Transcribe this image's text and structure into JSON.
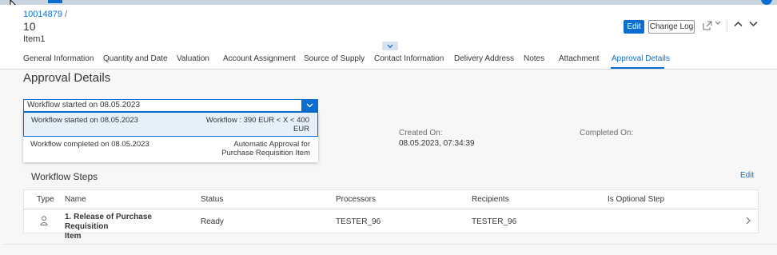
{
  "header": {
    "breadcrumb": "10014879",
    "breadcrumb_sep": "/",
    "title": "10",
    "subtitle": "Item1",
    "edit_label": "Edit",
    "changelog_label": "Change Log"
  },
  "tabs": [
    {
      "label": "General Information"
    },
    {
      "label": "Quantity and Date"
    },
    {
      "label": "Valuation"
    },
    {
      "label": "Account Assignment"
    },
    {
      "label": "Source of Supply"
    },
    {
      "label": "Contact Information"
    },
    {
      "label": "Delivery Address"
    },
    {
      "label": "Notes"
    },
    {
      "label": "Attachment"
    },
    {
      "label": "Approval Details"
    }
  ],
  "active_tab": "Approval Details",
  "section": {
    "title": "Approval Details",
    "workflow_select": {
      "value": "Workflow started on 08.05.2023",
      "options": [
        {
          "label": "Workflow started on 08.05.2023",
          "detail_line1": "Workflow : 390 EUR < X < 400",
          "detail_line2": "EUR"
        },
        {
          "label": "Workflow completed on 08.05.2023",
          "detail_line1": "Automatic Approval for",
          "detail_line2": "Purchase Requisition Item"
        }
      ]
    },
    "created_on_label": "Created On:",
    "created_on_value": "08.05.2023, 07:34:39",
    "completed_on_label": "Completed On:"
  },
  "steps": {
    "title": "Workflow Steps",
    "edit_label": "Edit",
    "columns": {
      "type": "Type",
      "name": "Name",
      "status": "Status",
      "processors": "Processors",
      "recipients": "Recipients",
      "optional": "Is Optional Step"
    },
    "rows": [
      {
        "type_icon": "user-icon",
        "name_line1": "1. Release of Purchase Requisition",
        "name_line2": "Item",
        "status": "Ready",
        "processors": "TESTER_96",
        "recipients": "TESTER_96",
        "optional": ""
      }
    ]
  },
  "colors": {
    "accent": "#0a6ed1",
    "selected_bg": "#e5f0fa",
    "text": "#32363a",
    "muted": "#6a6d70"
  }
}
